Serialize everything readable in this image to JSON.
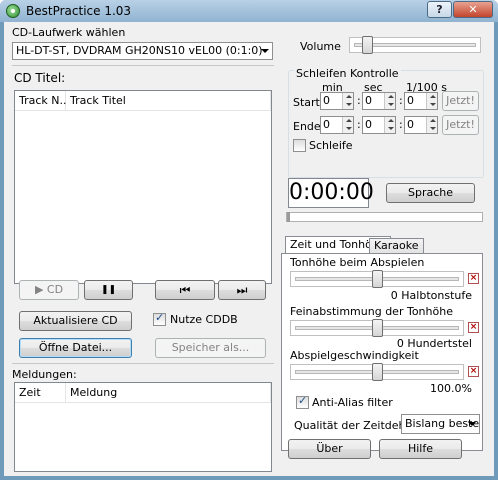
{
  "window": {
    "title": "BestPractice 1.03",
    "help_label": "?",
    "close_label": "✕"
  },
  "cd": {
    "drive_label": "CD-Laufwerk wählen",
    "drive_value": "HL-DT-ST, DVDRAM GH20NS10  vEL00 (0:1:0)",
    "titles_label": "CD Titel:",
    "columns": [
      "Track N...",
      "Track Titel"
    ]
  },
  "transport": {
    "play_label": "▶ CD",
    "pause_label": "❚❚",
    "prev_label": "⏮",
    "next_label": "⏭"
  },
  "actions": {
    "refresh_label": "Aktualisiere CD",
    "cddb_label": "Nutze CDDB",
    "cddb_checked": true,
    "open_label": "Öffne Datei...",
    "save_label": "Speicher als..."
  },
  "messages": {
    "label": "Meldungen:",
    "columns": [
      "Zeit",
      "Meldung"
    ]
  },
  "volume": {
    "label": "Volume",
    "level": 0.1
  },
  "loop": {
    "title": "Schleifen Kontrolle",
    "col_min": "min",
    "col_sec": "sec",
    "col_hundredth": "1/100 s",
    "start_label": "Start",
    "end_label": "Ende",
    "start_min": "0",
    "start_sec": "0",
    "start_hundredth": "0",
    "end_min": "0",
    "end_sec": "0",
    "end_hundredth": "0",
    "now_label": "Jetzt!",
    "repeat_label": "Schleife",
    "repeat_checked": false
  },
  "player": {
    "time": "0:00:00",
    "language_label": "Sprache",
    "position": 0.0
  },
  "tabs": {
    "active": "Zeit und Tonhöhe",
    "inactive": "Karaoke"
  },
  "pitch": {
    "label": "Tonhöhe beim Abspielen",
    "level": 0.5,
    "value": "0 Halbtonstufe",
    "fine_label": "Feinabstimmung der Tonhöhe",
    "fine_level": 0.5,
    "fine_value": "0 Hundertstel",
    "speed_label": "Abspielgeschwindigkeit",
    "speed_level": 0.5,
    "speed_value": "100.0%",
    "antialias_label": "Anti-Alias filter",
    "antialias_checked": true,
    "quality_label": "Qualität der Zeitdehnung",
    "quality_value": "Bislang beste..."
  },
  "footer": {
    "about_label": "Über",
    "help_label": "Hilfe"
  }
}
